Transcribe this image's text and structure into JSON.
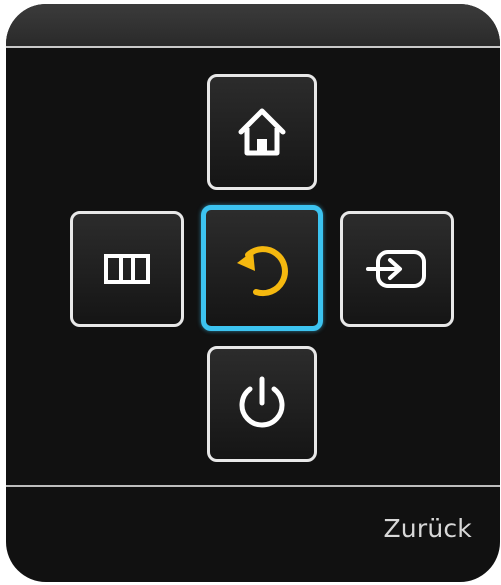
{
  "controls": {
    "home": {
      "icon": "home-icon"
    },
    "menu": {
      "icon": "menu-icon"
    },
    "back": {
      "icon": "return-icon",
      "focused": true
    },
    "source": {
      "icon": "source-input-icon"
    },
    "power": {
      "icon": "power-icon"
    }
  },
  "footer": {
    "label": "Zurück"
  },
  "colors": {
    "panel": "#111111",
    "button_border": "#e8e8e8",
    "focus_border": "#3cc3f0",
    "accent_icon": "#f5b80f",
    "icon": "#ffffff",
    "label_text": "#d8d8d8"
  }
}
